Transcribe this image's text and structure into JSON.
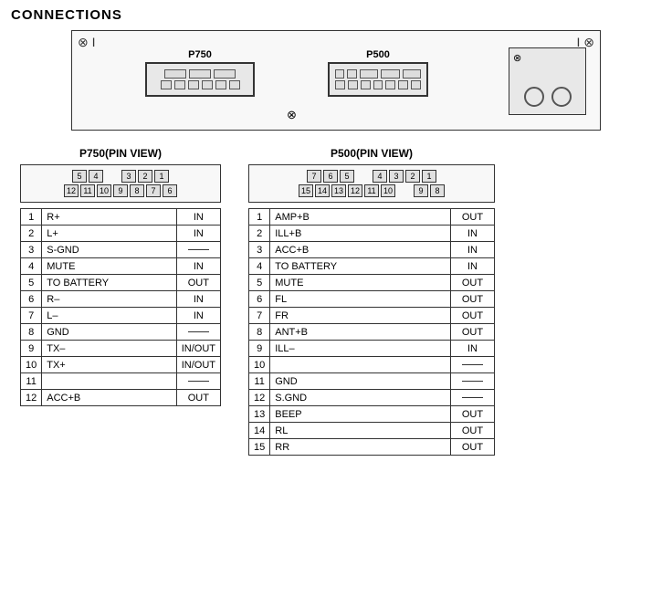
{
  "title": "CONNECTIONS",
  "diagram": {
    "label_p750": "P750",
    "label_p500": "P500"
  },
  "p750": {
    "pin_view_title": "P750(PIN VIEW)",
    "pin_view_top": [
      "5",
      "4",
      "",
      "3",
      "2",
      "1"
    ],
    "pin_view_bot": [
      "12",
      "11",
      "10",
      "9",
      "8",
      "7",
      "6"
    ],
    "rows": [
      {
        "pin": "1",
        "name": "R+",
        "dir": "IN"
      },
      {
        "pin": "2",
        "name": "L+",
        "dir": "IN"
      },
      {
        "pin": "3",
        "name": "S-GND",
        "dir": "—"
      },
      {
        "pin": "4",
        "name": "MUTE",
        "dir": "IN"
      },
      {
        "pin": "5",
        "name": "TO BATTERY",
        "dir": "OUT"
      },
      {
        "pin": "6",
        "name": "R–",
        "dir": "IN"
      },
      {
        "pin": "7",
        "name": "L–",
        "dir": "IN"
      },
      {
        "pin": "8",
        "name": "GND",
        "dir": "—"
      },
      {
        "pin": "9",
        "name": "TX–",
        "dir": "IN/OUT"
      },
      {
        "pin": "10",
        "name": "TX+",
        "dir": "IN/OUT"
      },
      {
        "pin": "11",
        "name": "",
        "dir": "—"
      },
      {
        "pin": "12",
        "name": "ACC+B",
        "dir": "OUT"
      }
    ]
  },
  "p500": {
    "pin_view_title": "P500(PIN VIEW)",
    "pin_view_top": [
      "7",
      "6",
      "5",
      "",
      "4",
      "3",
      "2",
      "1"
    ],
    "pin_view_bot": [
      "15",
      "14",
      "13",
      "12",
      "11",
      "10",
      "",
      "9",
      "8"
    ],
    "rows": [
      {
        "pin": "1",
        "name": "AMP+B",
        "dir": "OUT"
      },
      {
        "pin": "2",
        "name": "ILL+B",
        "dir": "IN"
      },
      {
        "pin": "3",
        "name": "ACC+B",
        "dir": "IN"
      },
      {
        "pin": "4",
        "name": "TO BATTERY",
        "dir": "IN"
      },
      {
        "pin": "5",
        "name": "MUTE",
        "dir": "OUT"
      },
      {
        "pin": "6",
        "name": "FL",
        "dir": "OUT"
      },
      {
        "pin": "7",
        "name": "FR",
        "dir": "OUT"
      },
      {
        "pin": "8",
        "name": "ANT+B",
        "dir": "OUT"
      },
      {
        "pin": "9",
        "name": "ILL–",
        "dir": "IN"
      },
      {
        "pin": "10",
        "name": "",
        "dir": "—"
      },
      {
        "pin": "11",
        "name": "GND",
        "dir": "—"
      },
      {
        "pin": "12",
        "name": "S.GND",
        "dir": "—"
      },
      {
        "pin": "13",
        "name": "BEEP",
        "dir": "OUT"
      },
      {
        "pin": "14",
        "name": "RL",
        "dir": "OUT"
      },
      {
        "pin": "15",
        "name": "RR",
        "dir": "OUT"
      }
    ]
  }
}
